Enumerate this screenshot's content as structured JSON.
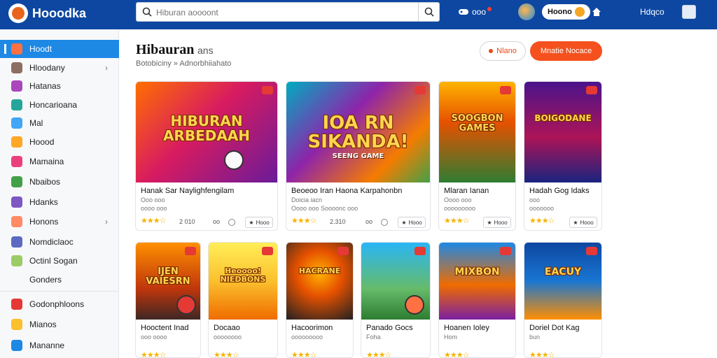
{
  "app": {
    "logo_text": "Hooodka",
    "search_placeholder": "Hiburan aoooont",
    "notif_label": "ooo",
    "coins_label": "Hoono",
    "user_label": "Hdqco"
  },
  "sidebar": {
    "items": [
      {
        "label": "Hoodt",
        "color": "#ff7043",
        "active": true
      },
      {
        "label": "Hloodany",
        "color": "#8d6e63",
        "chevron": true
      },
      {
        "label": "Hatanas",
        "color": "#ab47bc"
      },
      {
        "label": "Honcarioana",
        "color": "#26a69a"
      },
      {
        "label": "Mal",
        "color": "#42a5f5"
      },
      {
        "label": "Hoood",
        "color": "#ffa726"
      },
      {
        "label": "Mamaina",
        "color": "#ec407a"
      },
      {
        "label": "Nbaibos",
        "color": "#43a047"
      },
      {
        "label": "Hdanks",
        "color": "#7e57c2"
      },
      {
        "label": "Honons",
        "color": "#ff8a65",
        "chevron": true
      },
      {
        "label": "Nomdiclaoc",
        "color": "#5c6bc0"
      },
      {
        "label": "Octinl Sogan",
        "color": "#9ccc65"
      },
      {
        "label": "Gonders",
        "color": ""
      },
      {
        "label": "Godonphloons",
        "color": "#e53935"
      },
      {
        "label": "Mianos",
        "color": "#fbc02d"
      },
      {
        "label": "Mananne",
        "color": "#1e88e5"
      }
    ]
  },
  "main": {
    "title": "Hibauran",
    "title_sub": "ans",
    "breadcrumb": "Botobiciny  »  Adnorbhiiahato",
    "btn_outline": "Nlano",
    "btn_primary": "Mnatie Nocace"
  },
  "cards": [
    {
      "art_text": "HIBURAN ARBEDAAH",
      "art_sub": "",
      "title": "Hanak Sar Naylighfengilam",
      "meta": "Ooo    ooo",
      "meta2": "oooo ooo",
      "rating": "2 010",
      "btn": "Hooo",
      "extra": "oo"
    },
    {
      "art_text": "IOA RN SIKANDA!",
      "art_sub": "SEENG GAME",
      "title": "Beoeoo Iran Haona Karpahonbn",
      "meta": "Doicia iacn",
      "meta2": "Oooo ooo    Soooonc ooo",
      "rating": "2.310",
      "btn": "Hooo",
      "extra": "oo"
    },
    {
      "art_text": "SOOGBON GAMES",
      "art_sub": "",
      "title": "Mlaran Ianan",
      "meta": "Oooo ooo",
      "meta2": "ooooooooo",
      "rating": "",
      "btn": "Hooo",
      "extra": ""
    },
    {
      "art_text": "BOIGODANE",
      "art_sub": "",
      "title": "Hadah Gog Idaks",
      "meta": "ooo",
      "meta2": "ooooooo",
      "rating": "",
      "btn": "Hooo",
      "extra": ""
    },
    {
      "art_text": "IJEN VAIESRN",
      "art_sub": "",
      "title": "Hooctent Inad",
      "meta": "ooo oooo",
      "meta2": "",
      "rating": "",
      "btn": "",
      "extra": ""
    },
    {
      "art_text": "Heoooo! NIEDBONS",
      "art_sub": "",
      "title": "Docaao",
      "meta": "oooooooo",
      "meta2": "",
      "rating": "",
      "btn": "",
      "extra": ""
    },
    {
      "art_text": "HACRANE",
      "art_sub": "",
      "title": "Hacoorimon",
      "meta": "ooooooooo",
      "meta2": "",
      "rating": "",
      "btn": "",
      "extra": ""
    },
    {
      "art_text": "",
      "art_sub": "",
      "title": "Panado Gocs",
      "meta": "Foha",
      "meta2": "",
      "rating": "",
      "btn": "",
      "extra": ""
    },
    {
      "art_text": "MIXBON",
      "art_sub": "",
      "title": "Hoanen Ioley",
      "meta": "Hom",
      "meta2": "",
      "rating": "",
      "btn": "",
      "extra": ""
    },
    {
      "art_text": "EACUY",
      "art_sub": "",
      "title": "Doriel Dot Kag",
      "meta": "bun",
      "meta2": "",
      "rating": "",
      "btn": "",
      "extra": ""
    }
  ],
  "colors": {
    "topbar": "#0d47a1",
    "accent": "#1e88e5",
    "primary_button": "#f4511e"
  }
}
